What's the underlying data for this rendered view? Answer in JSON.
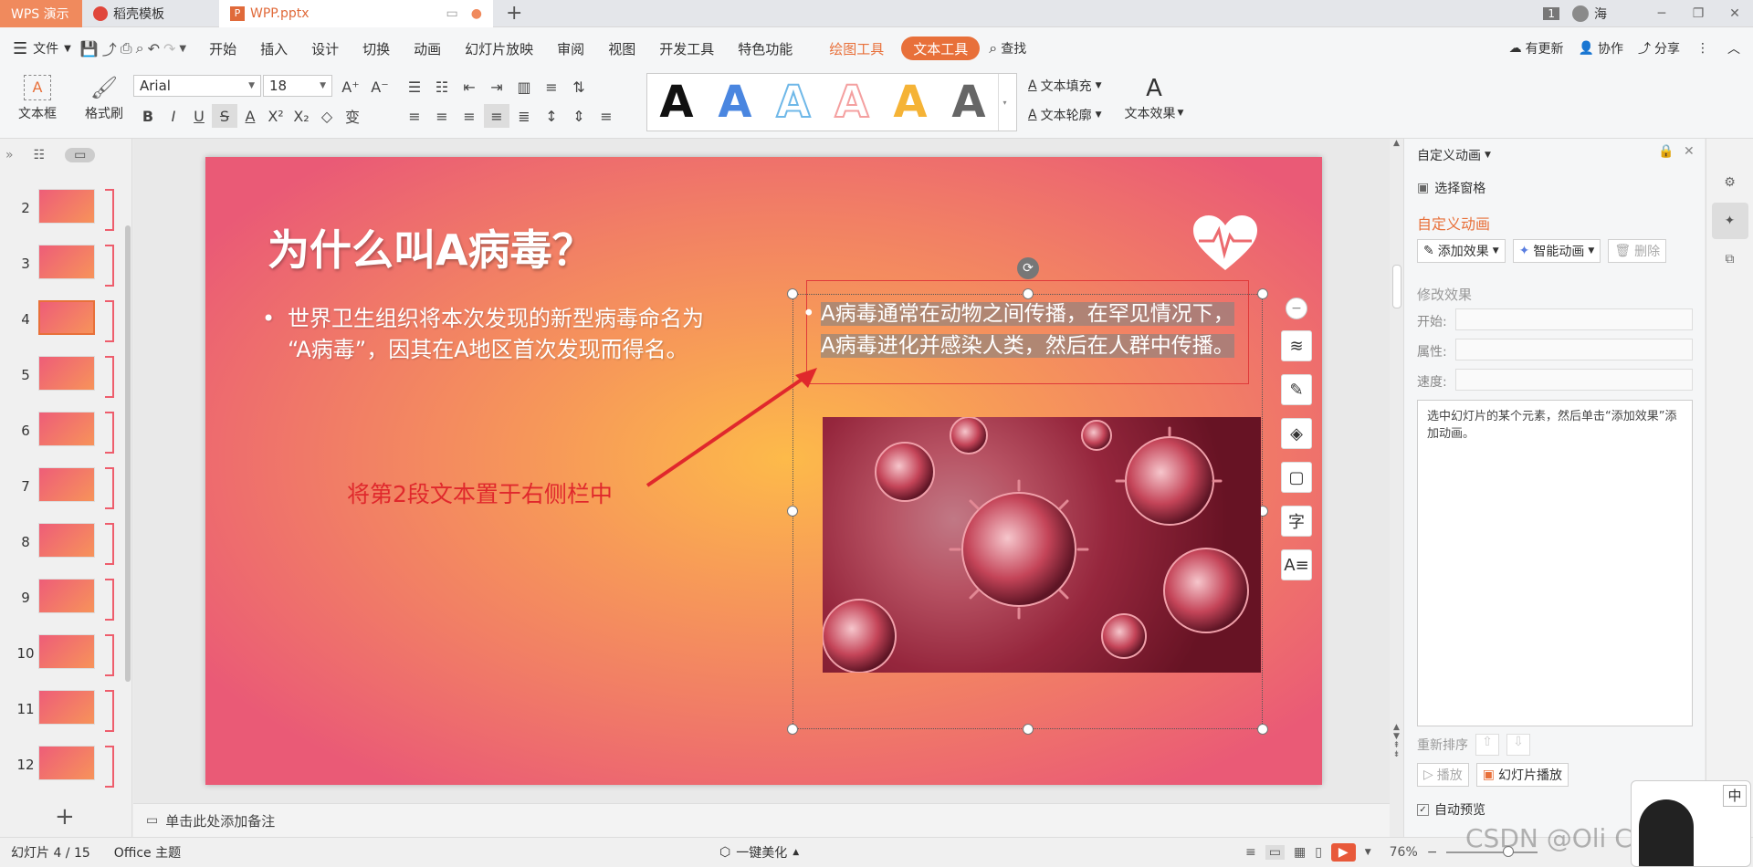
{
  "tabs": {
    "app": "WPS 演示",
    "template": "稻壳模板",
    "file": "WPP.pptx",
    "user_badge": "1",
    "user_name": "海"
  },
  "menu": {
    "file": "文件",
    "items": [
      "开始",
      "插入",
      "设计",
      "切换",
      "动画",
      "幻灯片放映",
      "审阅",
      "视图",
      "开发工具",
      "特色功能"
    ],
    "drawing_tools": "绘图工具",
    "text_tools": "文本工具",
    "search": "查找",
    "update": "有更新",
    "collab": "协作",
    "share": "分享"
  },
  "ribbon": {
    "textbox": "文本框",
    "format_painter": "格式刷",
    "font": "Arial",
    "size": "18",
    "fill": "文本填充",
    "outline": "文本轮廓",
    "effect": "文本效果",
    "styles": [
      {
        "letter": "A",
        "color": "#111111"
      },
      {
        "letter": "A",
        "color": "#4a86e0"
      },
      {
        "letter": "A",
        "color": "#6fb8e8"
      },
      {
        "letter": "A",
        "color": "#f4a0a0"
      },
      {
        "letter": "A",
        "color": "#f5b336"
      },
      {
        "letter": "A",
        "color": "#666666"
      }
    ]
  },
  "slides": [
    {
      "n": "2"
    },
    {
      "n": "3"
    },
    {
      "n": "4"
    },
    {
      "n": "5"
    },
    {
      "n": "6"
    },
    {
      "n": "7"
    },
    {
      "n": "8"
    },
    {
      "n": "9"
    },
    {
      "n": "10"
    },
    {
      "n": "11"
    },
    {
      "n": "12"
    }
  ],
  "current_slide_index": 2,
  "slide": {
    "title": "为什么叫A病毒？",
    "bullet1_line1": "世界卫生组织将本次发现的新型病毒命名为",
    "bullet1_line2": "“A病毒”，因其在A地区首次发现而得名。",
    "bullet2_line1": "A病毒通常在动物之间传播，在罕见情况下，",
    "bullet2_line2": "A病毒进化并感染人类，然后在人群中传播。",
    "annotation": "将第2段文本置于右侧栏中"
  },
  "notes_placeholder": "单击此处添加备注",
  "panel": {
    "title": "自定义动画",
    "select_pane": "选择窗格",
    "section_title": "自定义动画",
    "add_effect": "添加效果",
    "smart_anim": "智能动画",
    "delete": "删除",
    "modify": "修改效果",
    "start": "开始:",
    "property": "属性:",
    "speed": "速度:",
    "hint": "选中幻灯片的某个元素，然后单击“添加效果”添加动画。",
    "reorder": "重新排序",
    "play": "播放",
    "slideshow": "幻灯片播放",
    "auto_preview": "自动预览"
  },
  "status": {
    "slide_pos": "幻灯片 4 / 15",
    "theme": "Office 主题",
    "beautify": "一键美化",
    "zoom": "76%",
    "watermark": "CSDN @Oli Corect"
  },
  "colors": {
    "accent": "#e8703a",
    "wps_red": "#d9534f"
  }
}
